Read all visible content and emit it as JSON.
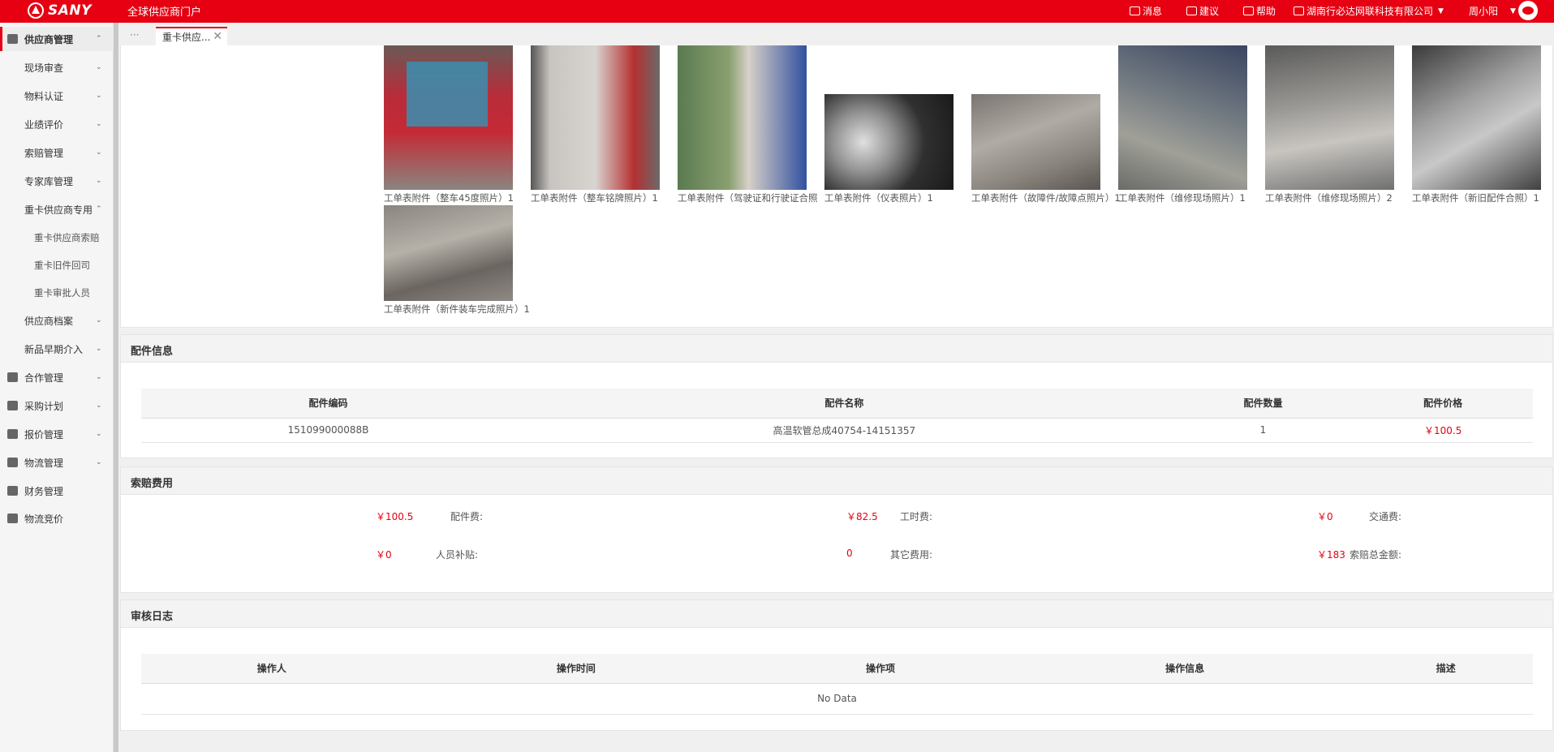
{
  "header": {
    "brand": "SANY",
    "portal_title": "全球供应商门户",
    "messages": "消息",
    "suggestion": "建议",
    "help": "帮助",
    "company": "湖南行必达网联科技有限公司",
    "user": "周小阳"
  },
  "sidebar": {
    "items": [
      {
        "label": "供应商管理",
        "chevron": "⌃"
      },
      {
        "label": "现场审查",
        "chevron": "⌄"
      },
      {
        "label": "物料认证",
        "chevron": "⌄"
      },
      {
        "label": "业绩评价",
        "chevron": "⌄"
      },
      {
        "label": "索赔管理",
        "chevron": "⌄"
      },
      {
        "label": "专家库管理",
        "chevron": "⌄"
      },
      {
        "label": "重卡供应商专用",
        "chevron": "⌃"
      },
      {
        "label": "重卡供应商索赔"
      },
      {
        "label": "重卡旧件回司"
      },
      {
        "label": "重卡审批人员"
      },
      {
        "label": "供应商档案",
        "chevron": "⌄"
      },
      {
        "label": "新品早期介入",
        "chevron": "⌄"
      },
      {
        "label": "合作管理",
        "chevron": "⌄"
      },
      {
        "label": "采购计划",
        "chevron": "⌄"
      },
      {
        "label": "报价管理",
        "chevron": "⌄"
      },
      {
        "label": "物流管理",
        "chevron": "⌄"
      },
      {
        "label": "财务管理"
      },
      {
        "label": "物流竞价"
      }
    ]
  },
  "tabs": {
    "more": "···",
    "active_label": "重卡供应...",
    "close": "✕"
  },
  "attachments": [
    {
      "caption": "工单表附件（整车45度照片）1"
    },
    {
      "caption": "工单表附件（整车铭牌照片）1"
    },
    {
      "caption": "工单表附件（驾驶证和行驶证合照"
    },
    {
      "caption": "工单表附件（仪表照片）1"
    },
    {
      "caption": "工单表附件（故障件/故障点照片）1"
    },
    {
      "caption": "工单表附件（维修现场照片）1"
    },
    {
      "caption": "工单表附件（维修现场照片）2"
    },
    {
      "caption": "工单表附件（新旧配件合照）1"
    },
    {
      "caption": "工单表附件（新件装车完成照片）1"
    }
  ],
  "parts": {
    "title": "配件信息",
    "columns": [
      "配件编码",
      "配件名称",
      "配件数量",
      "配件价格"
    ],
    "rows": [
      {
        "code": "151099000088B",
        "name": "高温软管总成40754-14151357",
        "qty": "1",
        "price": "￥100.5"
      }
    ]
  },
  "fees": {
    "title": "索赔费用",
    "parts_label": "配件费:",
    "parts_value": "￥100.5",
    "labor_label": "工时费:",
    "labor_value": "￥82.5",
    "traffic_label": "交通费:",
    "traffic_value": "￥0",
    "allowance_label": "人员补贴:",
    "allowance_value": "￥0",
    "other_label": "其它费用:",
    "other_value": "0",
    "total_label": "索赔总金额:",
    "total_value": "￥183"
  },
  "audit": {
    "title": "审核日志",
    "columns": [
      "操作人",
      "操作时间",
      "操作项",
      "操作信息",
      "描述"
    ],
    "empty": "No Data"
  },
  "colors": {
    "brand_red": "#e60012"
  }
}
